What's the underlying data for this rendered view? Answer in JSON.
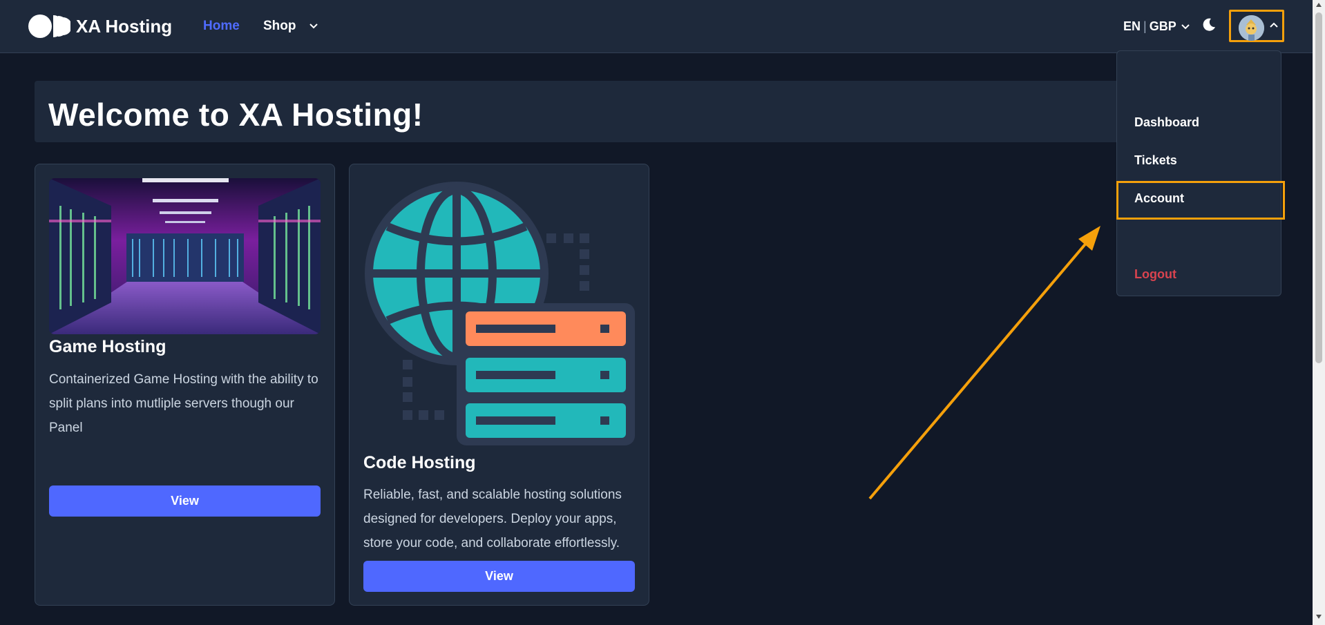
{
  "header": {
    "brand": "XA Hosting",
    "nav": {
      "home": "Home",
      "shop": "Shop"
    },
    "lang": "EN",
    "lang_sep": "|",
    "currency": "GBP"
  },
  "hero": {
    "title": "Welcome to XA Hosting!"
  },
  "cards": [
    {
      "title": "Game Hosting",
      "description": "Containerized Game Hosting with the ability to split plans into mutliple servers though our Panel",
      "button": "View"
    },
    {
      "title": "Code Hosting",
      "description": "Reliable, fast, and scalable hosting solutions designed for developers. Deploy your apps, store your code, and collaborate effortlessly.",
      "button": "View"
    }
  ],
  "dropdown": {
    "items": [
      "Dashboard",
      "Tickets",
      "Account",
      "Logout"
    ]
  },
  "colors": {
    "accent": "#4f68ff",
    "highlight": "#f5a00b",
    "logout": "#d9434f",
    "teal": "#22b8ba",
    "orange": "#ff8a5b"
  },
  "icons": [
    "logo-icon",
    "chevron-down-icon",
    "moon-icon",
    "avatar-icon",
    "chevron-up-icon",
    "globe-icon",
    "server-rack-icon"
  ]
}
